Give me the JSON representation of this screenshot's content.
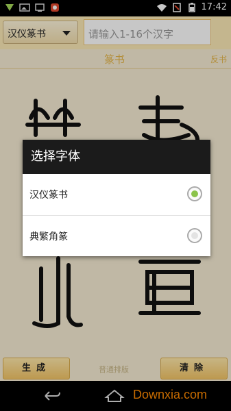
{
  "status_bar": {
    "time": "17:42"
  },
  "header": {
    "font_select_label": "汉仪篆书",
    "input_placeholder": "请输入1-16个汉字"
  },
  "tabs": {
    "main": "篆书",
    "side": "反书"
  },
  "dialog": {
    "title": "选择字体",
    "options": [
      {
        "label": "汉仪篆书",
        "selected": true
      },
      {
        "label": "典繁角篆",
        "selected": false
      }
    ]
  },
  "bottom": {
    "generate_label": "生成",
    "layout_mode": "普通排版",
    "clear_label": "清除"
  },
  "watermark": "Downxia.com",
  "colors": {
    "accent": "#e6b64a",
    "radio_selected": "#8bc34a",
    "dialog_title_bg": "#1b1b1b"
  }
}
